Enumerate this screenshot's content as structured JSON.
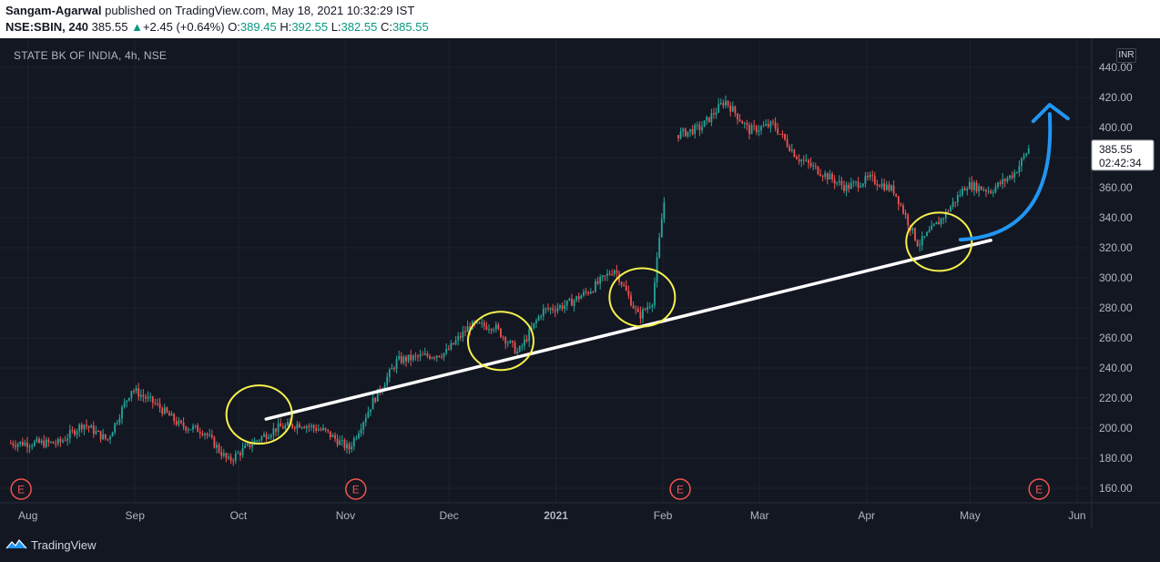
{
  "header": {
    "author": "Sangam-Agarwal",
    "published_text": "published on TradingView.com, May 18, 2021 10:32:29 IST",
    "symbol": "NSE:SBIN, 240",
    "last": "385.55",
    "change": "+2.45 (+0.64%)",
    "open_label": "O:",
    "open": "389.45",
    "high_label": "H:",
    "high": "392.55",
    "low_label": "L:",
    "low": "382.55",
    "close_label": "C:",
    "close": "385.55"
  },
  "chart_label": "STATE BK OF INDIA, 4h, NSE",
  "currency": "INR",
  "price_tag": {
    "price": "385.55",
    "countdown": "02:42:34"
  },
  "footer": {
    "brand": "TradingView",
    "logo_icon": "tradingview-logo-icon"
  },
  "colors": {
    "background": "#131722",
    "up": "#26a69a",
    "down": "#ef5350",
    "trendline": "#ffffff",
    "circles": "#f5f04c",
    "arrow": "#2196f3",
    "earnings": "#ef5350"
  },
  "chart_data": {
    "type": "candlestick",
    "title": "STATE BK OF INDIA, 4h, NSE",
    "y_ticks": [
      "440.00",
      "420.00",
      "400.00",
      "380.00",
      "360.00",
      "340.00",
      "320.00",
      "300.00",
      "280.00",
      "260.00",
      "240.00",
      "220.00",
      "200.00",
      "180.00",
      "160.00"
    ],
    "ylim": [
      150,
      450
    ],
    "x_ticks": [
      "Aug",
      "Sep",
      "Oct",
      "Nov",
      "Dec",
      "2021",
      "Feb",
      "Mar",
      "Apr",
      "May",
      "Jun"
    ],
    "earnings_markers": [
      "Aug",
      "Nov",
      "Feb",
      "May"
    ],
    "earnings_label": "E",
    "price_path": [
      {
        "date": "2020-07-27",
        "price": 190
      },
      {
        "date": "2020-08-10",
        "price": 190
      },
      {
        "date": "2020-08-17",
        "price": 203
      },
      {
        "date": "2020-08-24",
        "price": 192
      },
      {
        "date": "2020-08-31",
        "price": 226
      },
      {
        "date": "2020-09-07",
        "price": 216
      },
      {
        "date": "2020-09-14",
        "price": 202
      },
      {
        "date": "2020-09-21",
        "price": 198
      },
      {
        "date": "2020-09-28",
        "price": 178
      },
      {
        "date": "2020-10-05",
        "price": 190
      },
      {
        "date": "2020-10-12",
        "price": 200
      },
      {
        "date": "2020-10-19",
        "price": 203
      },
      {
        "date": "2020-10-26",
        "price": 198
      },
      {
        "date": "2020-11-02",
        "price": 186
      },
      {
        "date": "2020-11-09",
        "price": 218
      },
      {
        "date": "2020-11-16",
        "price": 245
      },
      {
        "date": "2020-11-30",
        "price": 250
      },
      {
        "date": "2020-12-07",
        "price": 268
      },
      {
        "date": "2020-12-14",
        "price": 268
      },
      {
        "date": "2020-12-21",
        "price": 250
      },
      {
        "date": "2020-12-28",
        "price": 278
      },
      {
        "date": "2021-01-04",
        "price": 282
      },
      {
        "date": "2021-01-11",
        "price": 292
      },
      {
        "date": "2021-01-18",
        "price": 306
      },
      {
        "date": "2021-01-25",
        "price": 274
      },
      {
        "date": "2021-01-29",
        "price": 285
      },
      {
        "date": "2021-02-01",
        "price": 346
      },
      {
        "date": "2021-02-05",
        "price": 395
      },
      {
        "date": "2021-02-12",
        "price": 400
      },
      {
        "date": "2021-02-19",
        "price": 418
      },
      {
        "date": "2021-02-26",
        "price": 398
      },
      {
        "date": "2021-03-05",
        "price": 402
      },
      {
        "date": "2021-03-12",
        "price": 380
      },
      {
        "date": "2021-03-19",
        "price": 370
      },
      {
        "date": "2021-03-26",
        "price": 360
      },
      {
        "date": "2021-04-02",
        "price": 366
      },
      {
        "date": "2021-04-09",
        "price": 358
      },
      {
        "date": "2021-04-16",
        "price": 322
      },
      {
        "date": "2021-04-23",
        "price": 340
      },
      {
        "date": "2021-04-30",
        "price": 362
      },
      {
        "date": "2021-05-07",
        "price": 358
      },
      {
        "date": "2021-05-14",
        "price": 370
      },
      {
        "date": "2021-05-18",
        "price": 386
      }
    ],
    "annotations": {
      "trendline": {
        "from": {
          "date": "2020-10-09",
          "price": 206
        },
        "to": {
          "date": "2021-05-07",
          "price": 325
        }
      },
      "circles": [
        {
          "date": "2020-10-07",
          "price": 209
        },
        {
          "date": "2020-12-16",
          "price": 258
        },
        {
          "date": "2021-01-26",
          "price": 287
        },
        {
          "date": "2021-04-22",
          "price": 324
        }
      ],
      "arrow": {
        "direction": "up"
      }
    }
  }
}
